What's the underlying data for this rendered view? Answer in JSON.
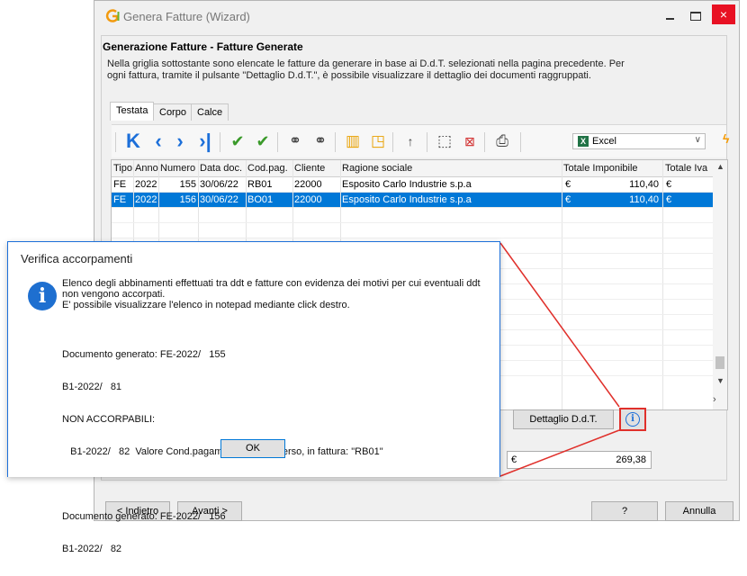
{
  "window": {
    "title": "Genera Fatture (Wizard)",
    "close_symbol": "×"
  },
  "panel": {
    "title": "Generazione Fatture - Fatture Generate",
    "description_line1": "Nella griglia sottostante sono elencate le fatture da generare in base ai D.d.T. selezionati nella pagina precedente. Per",
    "description_line2": "ogni fattura, tramite il pulsante \"Dettaglio D.d.T.\", è possibile visualizzare il dettaglio dei documenti raggruppati."
  },
  "tabs": [
    "Testata",
    "Corpo",
    "Calce"
  ],
  "toolbar": {
    "export_select": "Excel",
    "icons": [
      "first-icon",
      "prev-icon",
      "next-icon",
      "last-icon",
      "check-icon",
      "check-all-icon",
      "binoculars-icon",
      "find-next-icon",
      "columns-icon",
      "tag-icon",
      "sort-icon",
      "select-icon",
      "deselect-icon",
      "print-icon",
      "excel-icon",
      "flash-icon"
    ]
  },
  "grid": {
    "columns": [
      "Tipo",
      "Anno",
      "Numero",
      "Data doc.",
      "Cod.pag.",
      "Cliente",
      "Ragione sociale",
      "Totale Imponibile",
      "Totale Iva"
    ],
    "rows": [
      {
        "tipo": "FE",
        "anno": "2022",
        "numero": "155",
        "data": "30/06/22",
        "codpag": "RB01",
        "cliente": "22000",
        "ragione": "Esposito Carlo Industrie s.p.a",
        "imponibile_cur": "€",
        "imponibile": "110,40",
        "iva_cur": "€",
        "selected": false
      },
      {
        "tipo": "FE",
        "anno": "2022",
        "numero": "156",
        "data": "30/06/22",
        "codpag": "BO01",
        "cliente": "22000",
        "ragione": "Esposito Carlo Industrie s.p.a",
        "imponibile_cur": "€",
        "imponibile": "110,40",
        "iva_cur": "€",
        "selected": true
      }
    ]
  },
  "buttons": {
    "dettaglio": "Dettaglio D.d.T.",
    "indietro": "< Indietro",
    "avanti": "Avanti >",
    "help": "?",
    "annulla": "Annulla"
  },
  "total": {
    "currency": "€",
    "value": "269,38"
  },
  "dialog": {
    "title": "Verifica accorpamenti",
    "message_line1": "Elenco degli abbinamenti effettuati tra ddt e fatture con evidenza dei motivi per cui eventuali ddt",
    "message_line2": "non vengono accorpati.",
    "message_line3": "E' possibile visualizzare l'elenco in notepad mediante click destro.",
    "list": [
      "Documento generato: FE-2022/   155",
      "B1-2022/   81",
      "NON ACCORPABILI:",
      "   B1-2022/   82  Valore Cond.pagam. (\"BO01\") diverso, in fattura: \"RB01\"",
      "",
      "Documento generato: FE-2022/   156",
      "B1-2022/   82"
    ],
    "ok_label": "OK"
  },
  "colors": {
    "selection": "#0078d7",
    "callout": "#e0302b",
    "nav_blue": "#1c6fd9"
  }
}
